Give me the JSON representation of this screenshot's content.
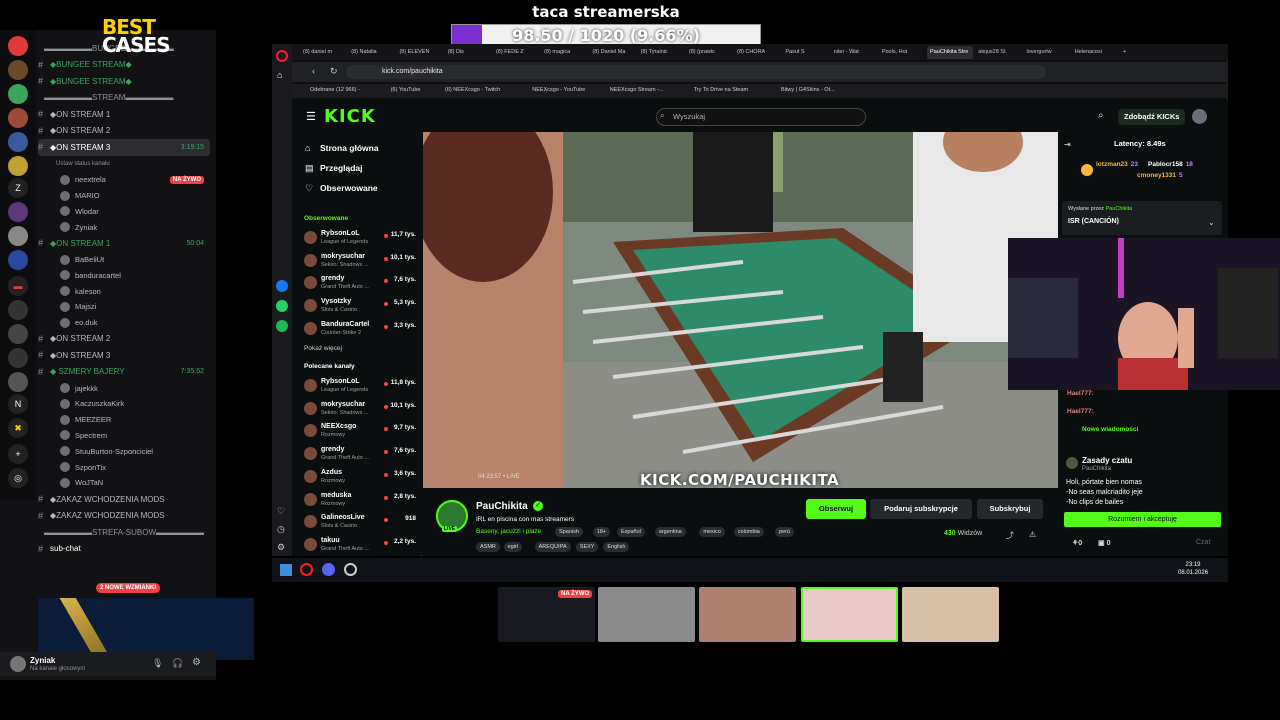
{
  "goal": {
    "title": "taca streamerska",
    "text": "98.50 / 1020 (9.66%)",
    "progress_fraction": 0.0966,
    "fill_color": "#7b2fd0"
  },
  "discord": {
    "channels": [
      {
        "type": "cat",
        "label": "▬▬▬▬▬▬BUNGEE▬▬▬▬▬▬"
      },
      {
        "type": "ch",
        "label": "◆BUNGEE STREAM◆",
        "color": "green"
      },
      {
        "type": "ch",
        "label": "◆BUNGEE STREAM◆",
        "color": "green"
      },
      {
        "type": "cat",
        "label": "▬▬▬▬▬▬STREAM▬▬▬▬▬▬"
      },
      {
        "type": "ch",
        "label": "◆ON STREAM 1"
      },
      {
        "type": "ch",
        "label": "◆ON STREAM 2"
      },
      {
        "type": "ch",
        "label": "◆ON STREAM 3",
        "active": true,
        "time": "3:19:15"
      },
      {
        "type": "sub",
        "label": "Ustaw status kanału"
      },
      {
        "type": "member",
        "label": "neextrela",
        "live": true
      },
      {
        "type": "member",
        "label": "MARIO"
      },
      {
        "type": "member",
        "label": "Wlodar"
      },
      {
        "type": "member",
        "label": "Zyniak"
      },
      {
        "type": "ch",
        "label": "◆ON STREAM 1",
        "color": "green",
        "time": "50:04"
      },
      {
        "type": "member",
        "label": "BaBeliUt"
      },
      {
        "type": "member",
        "label": "banduracartel"
      },
      {
        "type": "member",
        "label": "kaleson"
      },
      {
        "type": "member",
        "label": "Majszi"
      },
      {
        "type": "member",
        "label": "eo.duk"
      },
      {
        "type": "ch",
        "label": "◆ON STREAM 2"
      },
      {
        "type": "ch",
        "label": "◆ON STREAM 3"
      },
      {
        "type": "ch",
        "label": "◆ SZMERY BAJERY",
        "color": "green",
        "time": "7:35:52"
      },
      {
        "type": "member",
        "label": "jajekkk"
      },
      {
        "type": "member",
        "label": "KaczuszkaKirk"
      },
      {
        "type": "member",
        "label": "MEEZEER"
      },
      {
        "type": "member",
        "label": "Spectrem"
      },
      {
        "type": "member",
        "label": "StuuBurton-Szponciciel"
      },
      {
        "type": "member",
        "label": "SzponTix"
      },
      {
        "type": "member",
        "label": "WoJTaN"
      },
      {
        "type": "ch",
        "label": "◆ZAKAZ WCHODZENIA MODS"
      },
      {
        "type": "ch",
        "label": "◆ZAKAZ WCHODZENIA MODS"
      },
      {
        "type": "cat",
        "label": "▬▬▬▬▬▬STREFA-SUBOW▬▬▬▬▬▬"
      },
      {
        "type": "ch",
        "label": "sub-chat",
        "color": "white"
      }
    ],
    "live_badge": "NA ŻYWO",
    "mentions_badge": "2 NOWE WZMIANKI",
    "ad_text_1": "BEST",
    "ad_text_2": "CASES",
    "user_name": "Zyniak",
    "user_status": "Na kanale głosowym"
  },
  "browser": {
    "tabs": [
      "(8) daniel m",
      "(8) Natalia",
      "(8) ELEVEN",
      "(8) Dis",
      "(8) FEDE Z",
      "(8) magica",
      "(8) Daniel Ma",
      "(8) Tyralnic",
      "(8) (prawic",
      "(8) CHORA",
      "Pasut S",
      "niter - Wat",
      "Pools, Hot",
      "PauChikita Stre",
      "alejus28 St",
      "lovergurlw",
      "Helenacosi"
    ],
    "active_tab_index": 13,
    "url": "kick.com/pauchikita",
    "bookmarks": [
      "Odebrane (12 966) -",
      "(6) YouTube",
      "(6) NEEXcsgo - Twitch",
      "NEEXcsgo - YouTube",
      "NEEXcsgo Stream -...",
      "Try To Drive na Steam",
      "Bitwy | G4Skins - Ot..."
    ]
  },
  "kick": {
    "logo": "KICK",
    "search_placeholder": "Wyszukaj",
    "kicks_button": "Zdobądź KICKs",
    "nav": [
      "Strona główna",
      "Przeglądaj",
      "Obserwowane"
    ],
    "followed_header": "Obserwowane",
    "followed": [
      {
        "name": "RybsonLoL",
        "game": "League of Legends",
        "viewers": "11,7 tys."
      },
      {
        "name": "mokrysuchar",
        "game": "Sekiro: Shadows ...",
        "viewers": "10,1 tys."
      },
      {
        "name": "grendy",
        "game": "Grand Theft Auto ...",
        "viewers": "7,6 tys."
      },
      {
        "name": "Vysotzky",
        "game": "Slots & Casino",
        "viewers": "5,3 tys."
      },
      {
        "name": "BanduraCartel",
        "game": "Counter-Strike 2",
        "viewers": "3,3 tys."
      }
    ],
    "show_more": "Pokaż więcej",
    "recommended_header": "Polecane kanały",
    "recommended": [
      {
        "name": "RybsonLoL",
        "game": "League of Legends",
        "viewers": "11,8 tys."
      },
      {
        "name": "mokrysuchar",
        "game": "Sekiro: Shadows ...",
        "viewers": "10,1 tys."
      },
      {
        "name": "NEEXcsgo",
        "game": "Rozmowy",
        "viewers": "9,7 tys."
      },
      {
        "name": "grendy",
        "game": "Grand Theft Auto ...",
        "viewers": "7,6 tys."
      },
      {
        "name": "Azdus",
        "game": "Rozmowy",
        "viewers": "3,6 tys."
      },
      {
        "name": "meduska",
        "game": "Rozmowy",
        "viewers": "2,8 tys."
      },
      {
        "name": "GalineosLive",
        "game": "Slots & Casino",
        "viewers": "918"
      },
      {
        "name": "takuu",
        "game": "Grand Theft Auto ...",
        "viewers": "2,2 tys."
      }
    ],
    "video_overlay": "KICK.COM/PAUCHIKITA",
    "video_time": "04:23:57 • LIVE",
    "streamer": "PauChikita",
    "stream_title": "IRL en piscina con mas streamers",
    "category": "Baseny, jacuzzi i plaże",
    "tags_row1": [
      "Spanish",
      "18+",
      "Español",
      "argentina",
      "mexico",
      "colombia",
      "perú"
    ],
    "tags_row2": [
      "ASMR",
      "egirl",
      "AREQUIPA",
      "SEXY",
      "English"
    ],
    "follow_label": "Obserwuj",
    "gift_label": "Podaruj subskrypcje",
    "sub_label": "Subskrybuj",
    "viewers": "430",
    "viewers_word": "Widzów",
    "chat": {
      "latency": "Latency: 8.49s",
      "gifters": [
        {
          "name": "lotzman23",
          "count": "23"
        },
        {
          "name": "Pablocr158",
          "count": "18"
        },
        {
          "name": "cmoney1331",
          "count": "5"
        }
      ],
      "pinned_by_label": "Wysłane przez",
      "pinned_by": "PauChikita",
      "pinned_msg": "ISR (CANCIÓN)",
      "messages": [
        "Hael777:",
        "Hael777:"
      ],
      "new_messages": "Nowe wiadomości",
      "rules_title": "Zasady czatu",
      "rules_sub": "PauChikita",
      "rules": [
        "Holi, pórtate bien nomas",
        "-No seas malcriadito jeje",
        "-No clips de bailes"
      ],
      "accept": "Rozumiem i akceptuję",
      "send": "Czat",
      "counter1": "0",
      "counter2": "0"
    }
  },
  "taskbar": {
    "time": "23:19",
    "date": "08.01.2026"
  },
  "thumbs": {
    "live_badge": "NA ŻYWO"
  },
  "colors": {
    "kick_green": "#53fc18",
    "discord_bg": "#121214",
    "live_red": "#ed4245"
  }
}
